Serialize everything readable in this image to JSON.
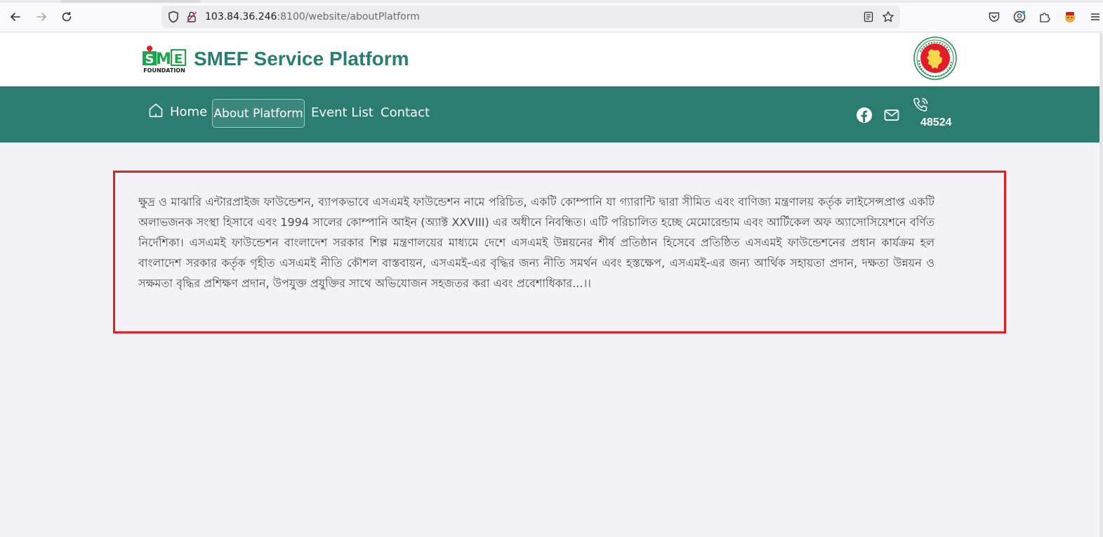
{
  "browser": {
    "url_host": "103.84.36.246",
    "url_path": ":8100/website/aboutPlatform",
    "icons": [
      "back-arrow-icon",
      "forward-arrow-icon",
      "reload-icon",
      "shield-icon",
      "insecure-lock-icon",
      "reader-view-icon",
      "bookmark-star-icon",
      "pocket-icon",
      "account-icon",
      "extensions-icon",
      "extension-avatar-icon",
      "menu-icon"
    ]
  },
  "header": {
    "logo_text_top": "SME",
    "logo_text_bottom": "FOUNDATION",
    "brand_title": "SMEF Service Platform"
  },
  "nav": {
    "home": "Home",
    "about": "About Platform",
    "events": "Event List",
    "contact": "Contact",
    "hotline": "48524"
  },
  "content": {
    "body": "ক্ষুদ্র ও মাঝারি এন্টারপ্রাইজ ফাউন্ডেশন, ব্যাপকভাবে এসএমই ফাউন্ডেশন নামে পরিচিত, একটি কোম্পানি যা গ্যারান্টি দ্বারা সীমিত এবং বাণিজ্য মন্ত্রণালয় কর্তৃক লাইসেন্সপ্রাপ্ত একটি অলাভজনক সংস্থা হিসাবে এবং 1994 সালের কোম্পানি আইন (অ্যাক্ট XXVIII) এর অধীনে নিবন্ধিত। এটি পরিচালিত হচ্ছে মেমোরেন্ডাম এবং আর্টিকেল অফ অ্যাসোসিয়েশনে বর্ণিত নির্দেশিকা। এসএমই ফাউন্ডেশন বাংলাদেশ সরকার শিল্প মন্ত্রণালয়ের মাধ্যমে দেশে এসএমই উন্নয়নের শীর্ষ প্রতিষ্ঠান হিসেবে প্রতিষ্ঠিত এসএমই ফাউন্ডেশনের প্রধান কার্যক্রম হল বাংলাদেশ সরকার কর্তৃক গৃহীত এসএমই নীতি কৌশল বাস্তবায়ন, এসএমই-এর বৃদ্ধির জন্য নীতি সমর্থন এবং হস্তক্ষেপ, এসএমই-এর জন্য আর্থিক সহায়তা প্রদান, দক্ষতা উন্নয়ন ও সক্ষমতা বৃদ্ধির প্রশিক্ষণ প্রদান, উপযুক্ত প্রযুক্তির সাথে অভিযোজন সহজতর করা এবং প্রবেশাধিকার...।।"
  },
  "colors": {
    "brand": "#2b7d72",
    "highlight_border": "#e81c23",
    "page_bg": "#f2f2f7"
  }
}
